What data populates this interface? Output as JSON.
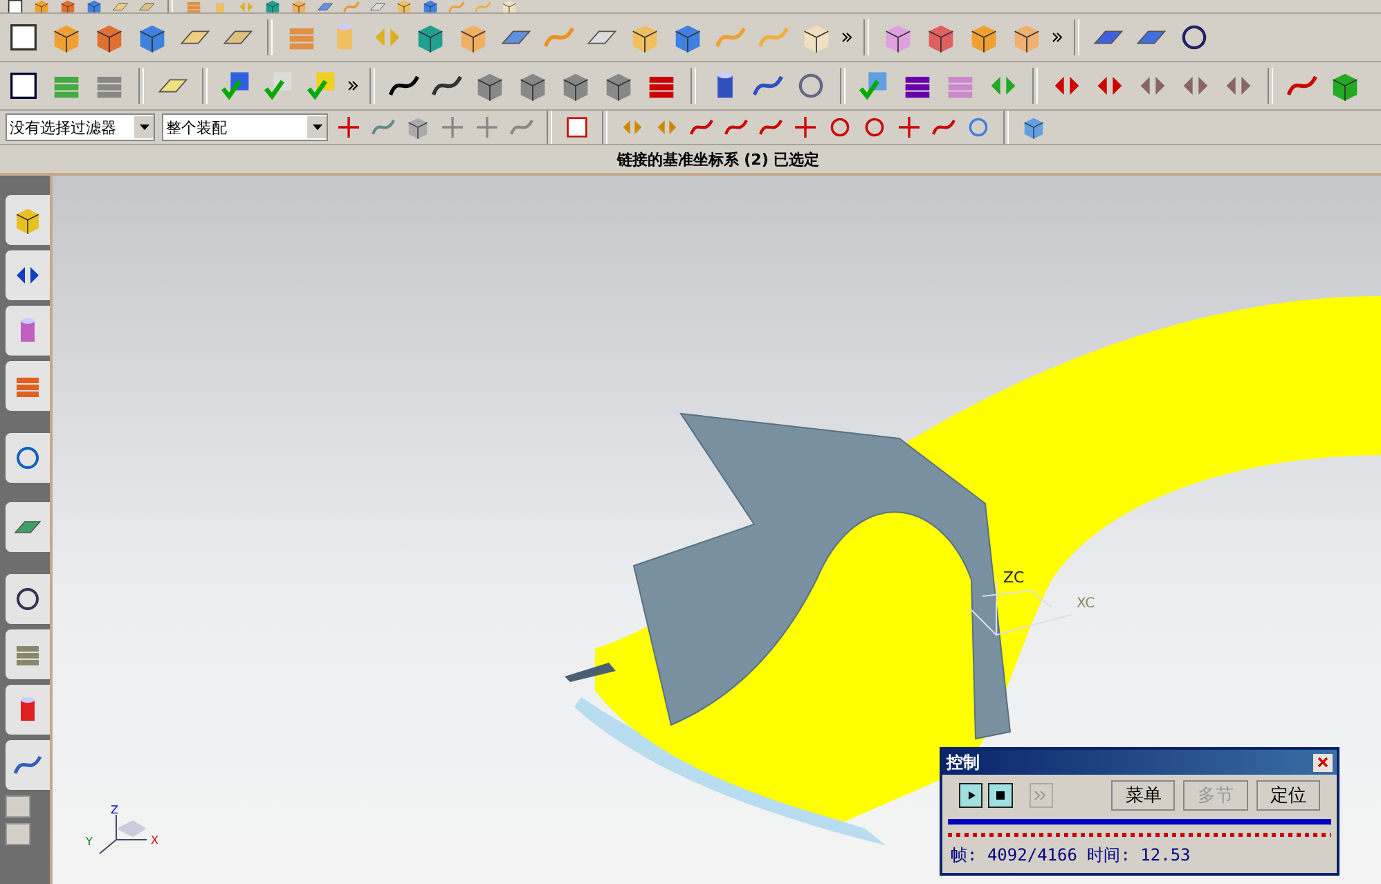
{
  "toolbar": {
    "filter_dropdown": {
      "value": "没有选择过滤器"
    },
    "scope_dropdown": {
      "value": "整个装配"
    }
  },
  "status_bar": {
    "message": "链接的基准坐标系 (2) 已选定"
  },
  "viewport": {
    "csys_labels": [
      "ZC",
      "XC"
    ],
    "triad_labels": [
      "Z",
      "Y",
      "X"
    ]
  },
  "control_dialog": {
    "title": "控制",
    "play_buttons": [
      {
        "kind": "play",
        "disabled": false
      },
      {
        "kind": "stop",
        "disabled": false
      },
      {
        "kind": "step",
        "disabled": true
      }
    ],
    "buttons": [
      {
        "label": "菜单",
        "disabled": false
      },
      {
        "label": "多节",
        "disabled": true
      },
      {
        "label": "定位",
        "disabled": false
      }
    ],
    "readout": "帧: 4092/4166 时间: 12.53"
  }
}
